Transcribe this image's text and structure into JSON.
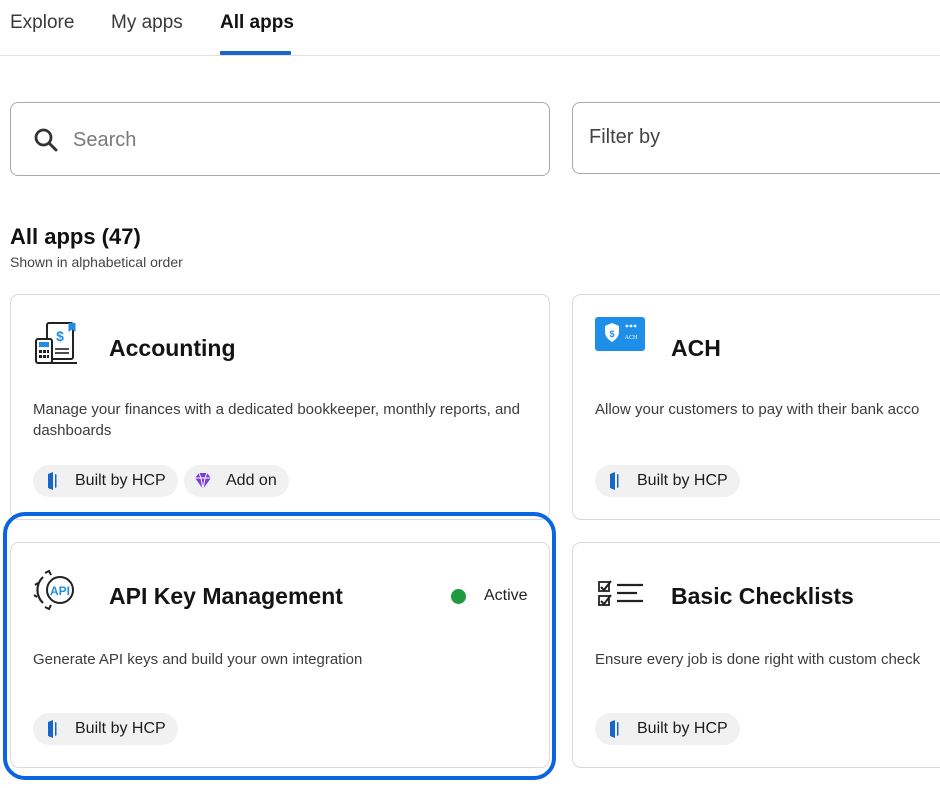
{
  "tabs": [
    {
      "label": "Explore",
      "active": false
    },
    {
      "label": "My apps",
      "active": false
    },
    {
      "label": "All apps",
      "active": true
    }
  ],
  "search": {
    "placeholder": "Search",
    "value": ""
  },
  "filter": {
    "label": "Filter by"
  },
  "section": {
    "title": "All apps (47)",
    "subtitle": "Shown in alphabetical order"
  },
  "apps": [
    {
      "name": "Accounting",
      "icon": "accounting-icon",
      "description": "Manage your finances with a dedicated bookkeeper, monthly reports, and dashboards",
      "chips": [
        {
          "label": "Built by HCP",
          "icon": "hcp-logo-icon"
        },
        {
          "label": "Add on",
          "icon": "diamond-icon"
        }
      ]
    },
    {
      "name": "ACH",
      "icon": "ach-icon",
      "description": "Allow your customers to pay with their bank acco",
      "chips": [
        {
          "label": "Built by HCP",
          "icon": "hcp-logo-icon"
        }
      ]
    },
    {
      "name": "API Key Management",
      "icon": "api-gear-icon",
      "status": "Active",
      "description": "Generate API keys and build your own integration",
      "chips": [
        {
          "label": "Built by HCP",
          "icon": "hcp-logo-icon"
        }
      ]
    },
    {
      "name": "Basic Checklists",
      "icon": "checklist-icon",
      "description": "Ensure every job is done right with custom check",
      "chips": [
        {
          "label": "Built by HCP",
          "icon": "hcp-logo-icon"
        }
      ]
    }
  ],
  "colors": {
    "accent": "#1a66c8",
    "highlight": "#0a66e0",
    "active_status": "#1f9a3e",
    "add_on": "#7b3fd6",
    "ach_icon_bg": "#1e8ee8"
  }
}
